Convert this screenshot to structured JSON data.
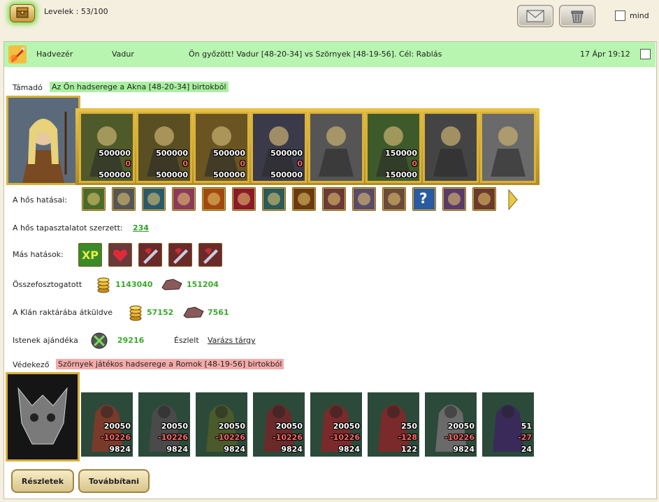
{
  "top": {
    "levelek": "Levelek : 53/100",
    "mind": "mind"
  },
  "header": {
    "type": "Hadvezér",
    "hero": "Vadur",
    "subject": "Ön győzött! Vadur [48-20-34] vs Szörnyek [48-19-56]. Cél: Rablás",
    "date": "17 Ápr 19:12"
  },
  "attacker": {
    "label": "Támadó",
    "desc": "Az Ön hadserege a Akna [48-20-34] birtokból",
    "units": [
      {
        "top": "500000",
        "mid": "0",
        "bot": "500000",
        "color": "#4f5a2a"
      },
      {
        "top": "500000",
        "mid": "0",
        "bot": "500000",
        "color": "#5a4f22"
      },
      {
        "top": "500000",
        "mid": "0",
        "bot": "500000",
        "color": "#6a5522"
      },
      {
        "top": "500000",
        "mid": "0",
        "bot": "500000",
        "color": "#3a3a4a"
      },
      {
        "top": "",
        "mid": "",
        "bot": "",
        "color": "#555"
      },
      {
        "top": "150000",
        "mid": "0",
        "bot": "150000",
        "color": "#3e5a2a"
      },
      {
        "top": "",
        "mid": "",
        "bot": "",
        "color": "#444"
      },
      {
        "top": "",
        "mid": "",
        "bot": "",
        "color": "#6a6a6a"
      }
    ]
  },
  "hero_effects": {
    "label": "A hős hatásai:",
    "icons": [
      "gem-icon",
      "helmet-icon",
      "orb-icon",
      "gift-icon",
      "fire-icon",
      "heart-icon",
      "shield-icon",
      "armor-icon",
      "amulet-icon",
      "mask-icon",
      "ring-icon",
      "question-icon",
      "bracelet-icon",
      "bow-icon"
    ]
  },
  "experience": {
    "label": "A hős tapasztalatot szerzett:",
    "value": "234"
  },
  "other_effects": {
    "label": "Más hatások:",
    "xp": "XP"
  },
  "plundered": {
    "label": "Összefosztogatott",
    "gold": "1143040",
    "ore": "151204"
  },
  "clan": {
    "label": "A Klán raktárába átküldve",
    "gold": "57152",
    "ore": "7561"
  },
  "gods": {
    "label": "Istenek ajándéka",
    "value": "29216",
    "found_label": "Észlelt",
    "found_link": "Varázs tárgy"
  },
  "defender": {
    "label": "Védekező",
    "desc": "Szörnyek játékos hadserege a Romok [48-19-56] birtokból",
    "units": [
      {
        "top": "20050",
        "mid": "-10226",
        "bot": "9824",
        "color": "#7a3a2a"
      },
      {
        "top": "20050",
        "mid": "-10226",
        "bot": "9824",
        "color": "#4a4a4a"
      },
      {
        "top": "20050",
        "mid": "-10226",
        "bot": "9824",
        "color": "#4a5a2a"
      },
      {
        "top": "20050",
        "mid": "-10226",
        "bot": "9824",
        "color": "#6a2a2a"
      },
      {
        "top": "20050",
        "mid": "-10226",
        "bot": "9824",
        "color": "#7a2a2a"
      },
      {
        "top": "250",
        "mid": "-128",
        "bot": "122",
        "color": "#7a2a2a"
      },
      {
        "top": "20050",
        "mid": "-10226",
        "bot": "9824",
        "color": "#6a6a6a"
      },
      {
        "top": "51",
        "mid": "-27",
        "bot": "24",
        "color": "#3a2a5a"
      }
    ]
  },
  "buttons": {
    "details": "Részletek",
    "forward": "Továbbítani"
  }
}
